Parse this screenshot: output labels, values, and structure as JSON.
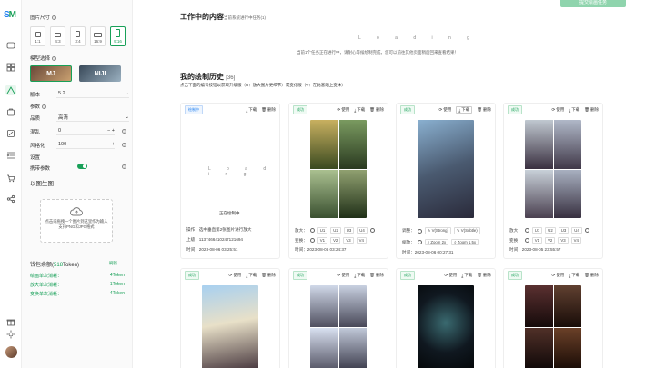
{
  "app": {
    "logo_a": "S",
    "logo_b": "M"
  },
  "panel": {
    "size_label": "图片尺寸",
    "ratios": [
      "1:1",
      "4:3",
      "3:4",
      "16:9",
      "9:16"
    ],
    "model_label": "模型选择",
    "models": [
      "MJ",
      "NIJI"
    ],
    "version_label": "版本",
    "version_value": "5.2",
    "params_label": "参数",
    "quality_label": "品质",
    "quality_value": "高清",
    "chaos_label": "混乱",
    "chaos_value": "0",
    "style_label": "风格化",
    "style_value": "100",
    "settings_label": "设置",
    "carry_label": "携带参数",
    "img2img_label": "以图生图",
    "upload_text_1": "点击或拖拽一个图片到这里作为输入",
    "upload_text_2": "支持PNG和JPG格式",
    "wallet_label": "钱包余额",
    "wallet_amount": "518",
    "wallet_unit": "Token",
    "wallet_refresh": "刷新",
    "wallet_lines": [
      {
        "k": "绘画单次消耗：",
        "v": "4Token"
      },
      {
        "k": "放大单次消耗：",
        "v": "1Token"
      },
      {
        "k": "变换单次消耗：",
        "v": "4Token"
      }
    ]
  },
  "main": {
    "top_button": "提交绘画任务",
    "working_title": "工作中的内容",
    "working_sub": "当前系统进行中任务(1)",
    "working_dots": "L o a d i n g",
    "working_note": "当前1个任务正在进行中，请耐心等候绘制完成，您可以前往其他页面稍后回来查看结果！",
    "history_title": "我的绘制历史",
    "history_count": "[36]",
    "history_sub": "点击下面的编号按钮以获取升级版（U：放大图片更细节）或变化版（V：在此基础上变体）",
    "cards": [
      {
        "status": "绘制中",
        "acts": [
          "下载",
          "删除"
        ],
        "loading": "L o a d i n g",
        "progress": "正在绘制中...",
        "line1": "操作：选中垂直第2张图片进行放大",
        "line2": "上级：1137466410247121694",
        "line3": "时间：2023-08-06 03:25:51"
      },
      {
        "status": "成功",
        "acts": [
          "使用",
          "下载",
          "删除"
        ],
        "zoom": "放大：",
        "var": "变换：",
        "u": [
          "U1",
          "U2",
          "U3",
          "U4"
        ],
        "v": [
          "V1",
          "V2",
          "V3",
          "V4"
        ],
        "time": "时间：2023-08-06 03:24:37"
      },
      {
        "status": "成功",
        "acts": [
          "使用",
          "下载",
          "删除"
        ],
        "adjust": "调整：",
        "vs": "V(Strong)",
        "vsub": "V(Subtle)",
        "shrink": "缩放：",
        "z2": "Zoom 2x",
        "z15": "Zoom 1.5x",
        "time": "时间：2023-08-06 00:27:31"
      },
      {
        "status": "成功",
        "acts": [
          "使用",
          "下载",
          "删除"
        ],
        "zoom": "放大：",
        "var": "变换：",
        "u": [
          "U1",
          "U2",
          "U3",
          "U4"
        ],
        "v": [
          "V1",
          "V2",
          "V3",
          "V4"
        ],
        "time": "时间：2023-08-05 23:55:57"
      },
      {
        "status": "成功",
        "acts": [
          "使用",
          "下载",
          "删除"
        ]
      },
      {
        "status": "成功",
        "acts": [
          "使用",
          "下载",
          "删除"
        ]
      },
      {
        "status": "成功",
        "acts": [
          "使用",
          "下载",
          "删除"
        ]
      },
      {
        "status": "成功",
        "acts": [
          "使用",
          "下载",
          "删除"
        ]
      }
    ]
  },
  "colors": {
    "accent": "#18a058",
    "blue": "#2080f0"
  }
}
